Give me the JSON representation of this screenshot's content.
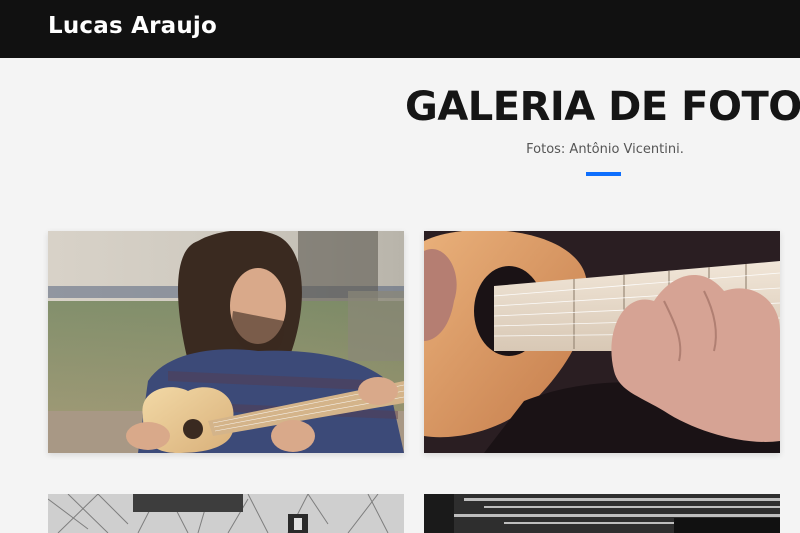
{
  "navbar": {
    "brand": "Lucas Araujo"
  },
  "gallery": {
    "title": "GALERIA DE FOTOS",
    "subtitle": "Fotos: Antônio Vicentini.",
    "accent_color": "#0d6efd",
    "photos": [
      {
        "subject": "man-playing-acoustic-guitar"
      },
      {
        "subject": "hands-on-guitar-fretboard"
      },
      {
        "subject": "black-and-white-guitar-photo"
      },
      {
        "subject": "black-and-white-guitar-closeup"
      }
    ]
  }
}
